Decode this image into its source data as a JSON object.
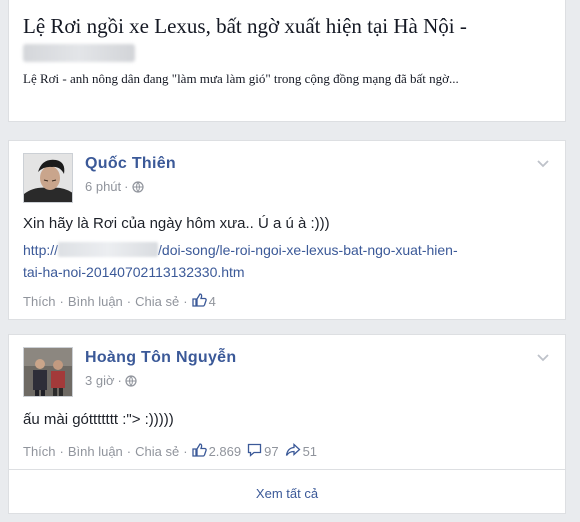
{
  "link_preview": {
    "title": "Lệ Rơi ngồi xe Lexus, bất ngờ xuất hiện tại Hà Nội -",
    "description": "Lệ Rơi - anh nông dân đang \"làm mưa làm gió\" trong cộng đồng mạng đã bất ngờ..."
  },
  "comments": [
    {
      "author": "Quốc Thiên",
      "time": "6 phút",
      "text": "Xin hãy là Rơi của ngày hôm xưa.. Ú a ú à :)))",
      "link_start": "http://",
      "link_rest": "/doi-song/le-roi-ngoi-xe-lexus-bat-ngo-xuat-hien-",
      "link_line2": "tai-ha-noi-20140702113132330.htm",
      "actions": {
        "like": "Thích",
        "reply": "Bình luận",
        "share": "Chia sẻ",
        "separator": "·"
      },
      "likes": "4"
    },
    {
      "author": "Hoàng Tôn Nguyễn",
      "time": "3 giờ",
      "text": "ấu mài góttttttt :\"> :)))))",
      "actions": {
        "like": "Thích",
        "reply": "Bình luận",
        "share": "Chia sẻ",
        "separator": "·"
      },
      "likes": "2.869",
      "replies": "97",
      "shares": "51"
    }
  ],
  "see_all": "Xem tất cả",
  "icons": {
    "globe": "globe-icon",
    "chevron": "chevron-down-icon",
    "like": "thumbs-up-icon",
    "reply": "comment-bubble-icon",
    "share": "share-arrow-icon"
  },
  "colors": {
    "link": "#3b5998",
    "muted": "#90949c",
    "background": "#e9ebee"
  }
}
